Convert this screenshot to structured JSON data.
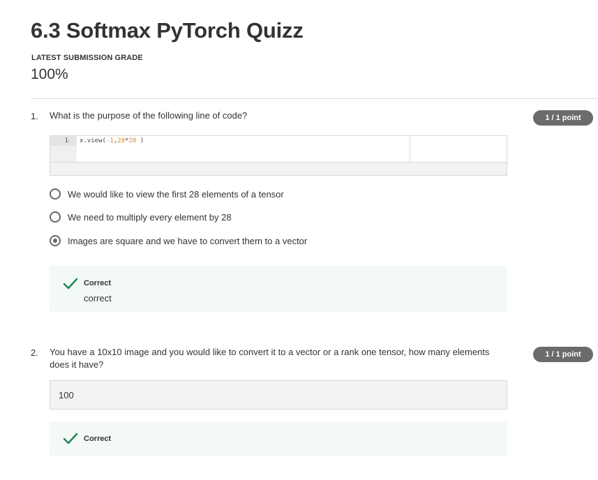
{
  "page": {
    "title": "6.3 Softmax PyTorch Quizz",
    "grade_label": "LATEST SUBMISSION GRADE",
    "grade_value": "100%"
  },
  "questions": [
    {
      "number": "1.",
      "text": "What is the purpose of the following line of code?",
      "points": "1 / 1 point",
      "code": {
        "line_number": "1",
        "tokens": [
          "x.view(",
          "-1",
          ",",
          "28",
          "*",
          "28",
          " )"
        ]
      },
      "options": [
        {
          "label": "We would like to view the first 28 elements of a tensor",
          "selected": false
        },
        {
          "label": "We need to multiply every element by 28",
          "selected": false
        },
        {
          "label": "Images are square and we have to convert them to a vector",
          "selected": true
        }
      ],
      "feedback": {
        "status": "Correct",
        "text": "correct",
        "icon": "check-icon"
      }
    },
    {
      "number": "2.",
      "text_line1": "You have a 10x10 image and you would like to convert it to a vector or a rank one tensor, how many elements",
      "text_line2": "does it have?",
      "points": "1 / 1 point",
      "answer": "100",
      "feedback": {
        "status": "Correct",
        "icon": "check-icon"
      }
    }
  ],
  "colors": {
    "badge": "#6b6b6b",
    "feedback_bg": "#f3f9f6",
    "check": "#1f8354",
    "code_number": "#e0892c"
  }
}
